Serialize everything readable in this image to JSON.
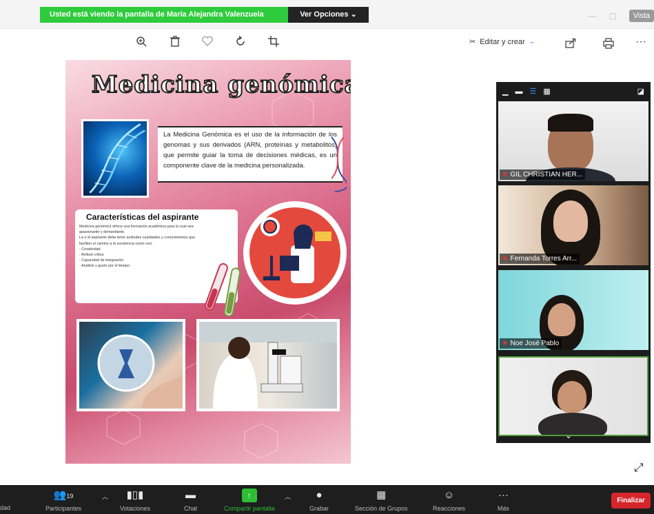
{
  "banner": {
    "share_text": "Usted está viendo la pantalla de María Alejandra Valenzuela",
    "options_label": "Ver Opciones ⌄",
    "vista_label": "Vista"
  },
  "viewer_toolbar": {
    "icons": [
      "zoom-in-icon",
      "trash-icon",
      "heart-icon",
      "rotate-icon",
      "crop-icon"
    ],
    "edit_create_label": "Editar y crear"
  },
  "poster": {
    "title": "Medicina genómica",
    "intro": "La Medicina Genómica es el uso de la información de los genomas y sus derivados (ARN, proteínas y metabolitos) que permite guiar la toma de decisiones médicas, es un componente clave de la medicina personalizada.",
    "section_title": "Características del aspirante",
    "section_lines": [
      "Medicina genómica ofrece una formación académica para la cual sea",
      "apasionante y demandante.",
      "La o el aspirante debe tener actitudes cualidades y conocimientos que",
      "faciliten el camino a la excelencia como son:",
      "- Creatividad",
      "- Actitud crítica",
      "- Capacidad de integración",
      "- Análisis y gusto por el tiempo"
    ]
  },
  "participants_panel": {
    "tiles": [
      {
        "name": "GIL CHRISTIAN HER..."
      },
      {
        "name": "Fernanda Torres Arr..."
      },
      {
        "name": "Noe José Pablo"
      },
      {
        "name": ""
      }
    ]
  },
  "bottom_bar": {
    "partial_left_label": "dad",
    "participants_label": "Participantes",
    "participants_count": "19",
    "votaciones_label": "Votaciones",
    "chat_label": "Chat",
    "share_label": "Compartir pantalla",
    "grabar_label": "Grabar",
    "grupos_label": "Sección de Grupos",
    "reacciones_label": "Reacciones",
    "mas_label": "Más",
    "end_label": "Finalizar"
  },
  "colors": {
    "share_green": "#2ecc3c",
    "end_red": "#d5262b",
    "toolbar_dark": "#1e1e1e",
    "panel_dark": "#1c1c1c"
  }
}
